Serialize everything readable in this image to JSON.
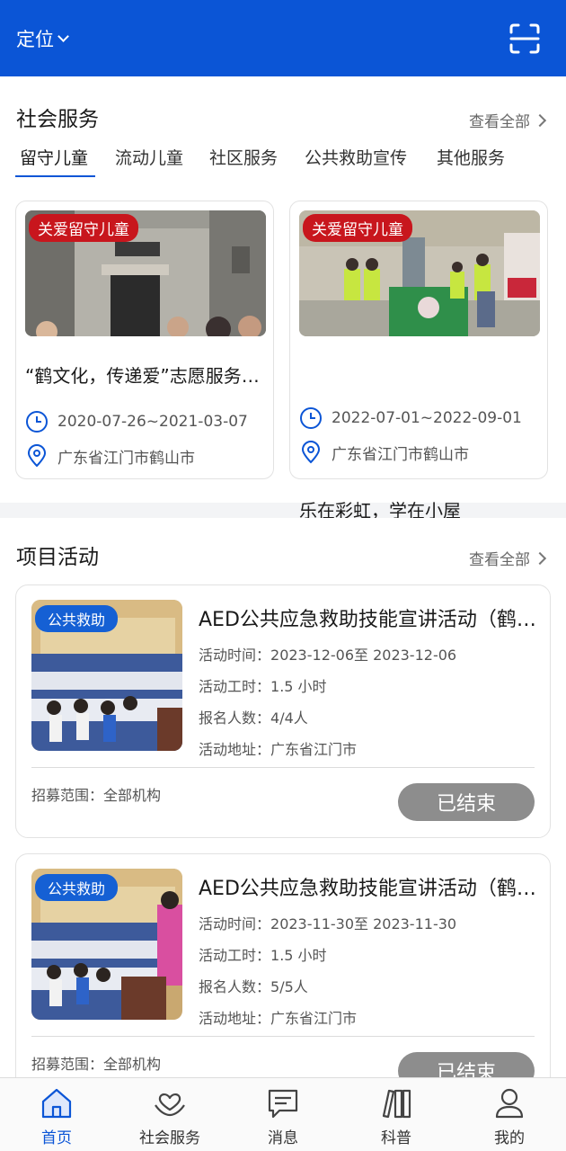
{
  "header": {
    "location_label": "定位"
  },
  "social_service": {
    "title": "社会服务",
    "view_all": "查看全部",
    "tabs": [
      "留守儿童",
      "流动儿童",
      "社区服务",
      "公共救助宣传",
      "其他服务"
    ],
    "active_tab": 0,
    "cards": [
      {
        "badge": "关爱留守儿童",
        "title": "“鹤文化，传递爱”志愿服务活动",
        "date": "2020-07-26~2021-03-07",
        "address": "广东省江门市鹤山市"
      },
      {
        "badge": "关爱留守儿童",
        "title": "乐在彩虹，学在小屋",
        "date": "2022-07-01~2022-09-01",
        "address": "广东省江门市鹤山市"
      }
    ]
  },
  "projects": {
    "title": "项目活动",
    "view_all": "查看全部",
    "cards": [
      {
        "badge": "公共救助",
        "title": "AED公共应急救助技能宣讲活动（鹤山）",
        "time_label": "活动时间：",
        "time": "2023-12-06至 2023-12-06",
        "hours_label": "活动工时：",
        "hours": "1.5 小时",
        "count_label": "报名人数：",
        "count": "4/4人",
        "addr_label": "活动地址：",
        "addr": "广东省江门市",
        "scope_label": "招募范围：",
        "scope": "全部机构",
        "status": "已结束"
      },
      {
        "badge": "公共救助",
        "title": "AED公共应急救助技能宣讲活动（鹤山）",
        "time_label": "活动时间：",
        "time": "2023-11-30至 2023-11-30",
        "hours_label": "活动工时：",
        "hours": "1.5 小时",
        "count_label": "报名人数：",
        "count": "5/5人",
        "addr_label": "活动地址：",
        "addr": "广东省江门市",
        "scope_label": "招募范围：",
        "scope": "全部机构",
        "status": "已结束"
      }
    ]
  },
  "bottom_nav": [
    {
      "label": "首页",
      "icon": "home-icon",
      "active": true
    },
    {
      "label": "社会服务",
      "icon": "heart-hands-icon",
      "active": false
    },
    {
      "label": "消息",
      "icon": "message-icon",
      "active": false
    },
    {
      "label": "科普",
      "icon": "books-icon",
      "active": false
    },
    {
      "label": "我的",
      "icon": "user-icon",
      "active": false
    }
  ],
  "colors": {
    "primary": "#0b55d6",
    "badge_red": "#c8161d",
    "badge_blue": "#1560d4",
    "ended_button": "#8d8d8d"
  }
}
